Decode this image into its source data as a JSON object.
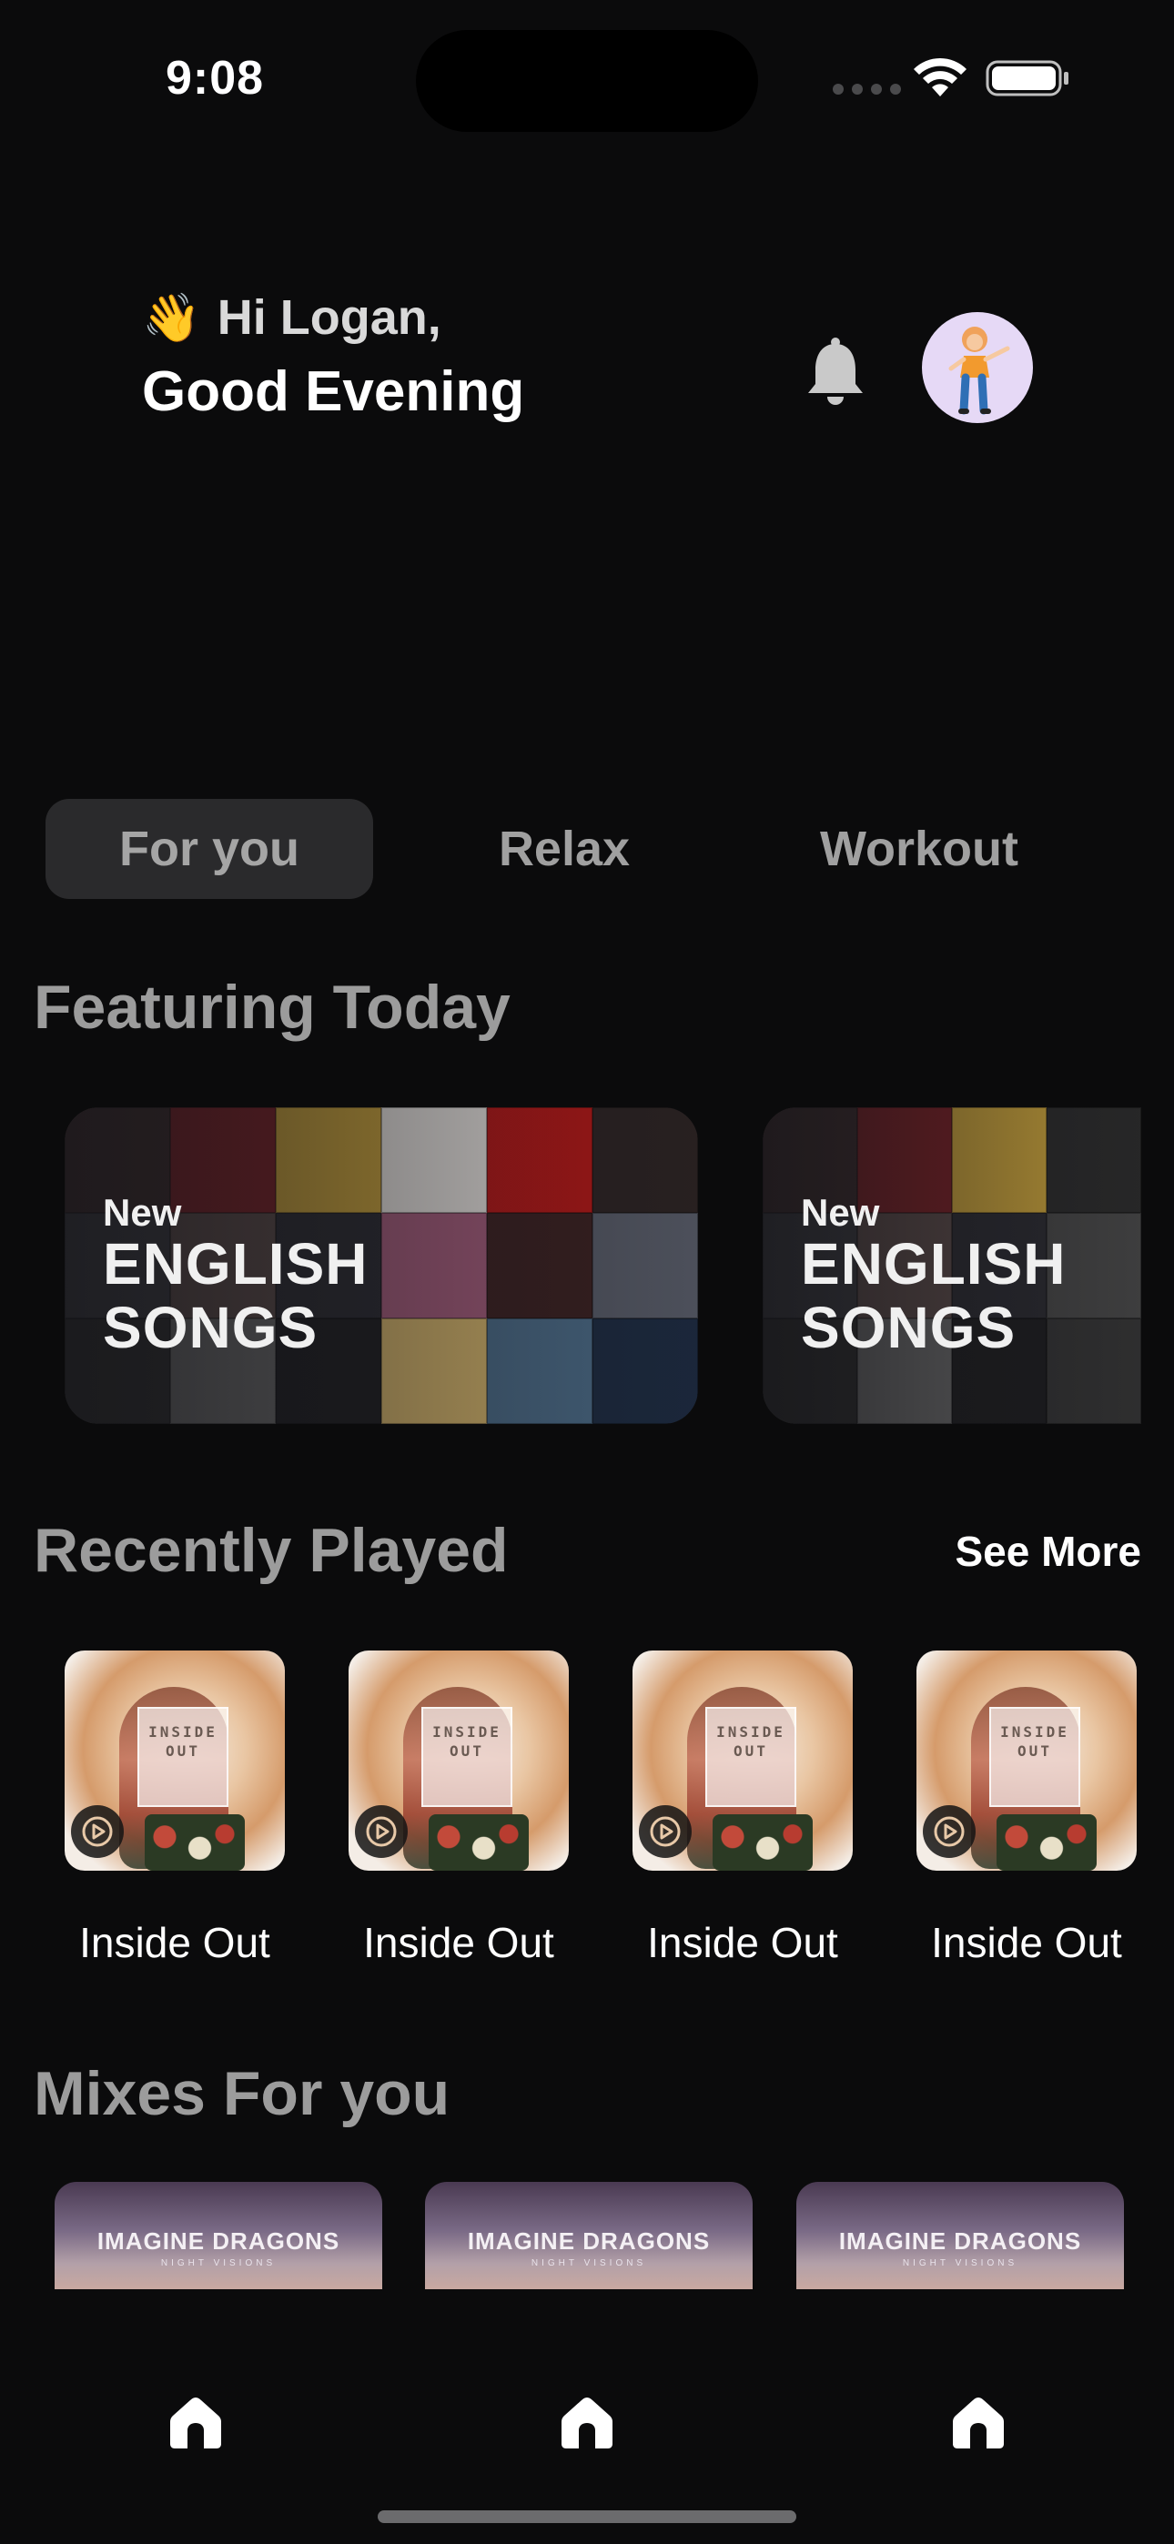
{
  "status_bar": {
    "time": "9:08"
  },
  "header": {
    "wave_emoji": "👋",
    "greeting": "Hi Logan,",
    "subtitle": "Good Evening"
  },
  "tabs": [
    {
      "label": "For you",
      "active": true
    },
    {
      "label": "Relax",
      "active": false
    },
    {
      "label": "Workout",
      "active": false
    }
  ],
  "featuring": {
    "title": "Featuring Today",
    "cards": [
      {
        "tag": "New",
        "line1": "ENGLISH",
        "line2": "SONGS"
      },
      {
        "tag": "New",
        "line1": "ENGLISH",
        "line2": "SONGS"
      }
    ]
  },
  "recently_played": {
    "title": "Recently Played",
    "see_more": "See More",
    "album_art_text": "INSIDE OUT",
    "items": [
      {
        "label": "Inside Out"
      },
      {
        "label": "Inside Out"
      },
      {
        "label": "Inside Out"
      },
      {
        "label": "Inside Out"
      }
    ]
  },
  "mixes": {
    "title": "Mixes For you",
    "items": [
      {
        "art_text": "IMAGINE DRAGONS",
        "art_sub": "NIGHT VISIONS"
      },
      {
        "art_text": "IMAGINE DRAGONS",
        "art_sub": "NIGHT VISIONS"
      },
      {
        "art_text": "IMAGINE DRAGONS",
        "art_sub": "NIGHT VISIONS"
      }
    ]
  },
  "bottom_nav": [
    {
      "icon": "home-icon"
    },
    {
      "icon": "home-icon"
    },
    {
      "icon": "home-icon"
    }
  ],
  "colors": {
    "background": "#0b0b0c",
    "active_tab_bg": "#2a2a2c",
    "section_title": "#9c9c9c",
    "avatar_bg": "#e6d9f6"
  }
}
